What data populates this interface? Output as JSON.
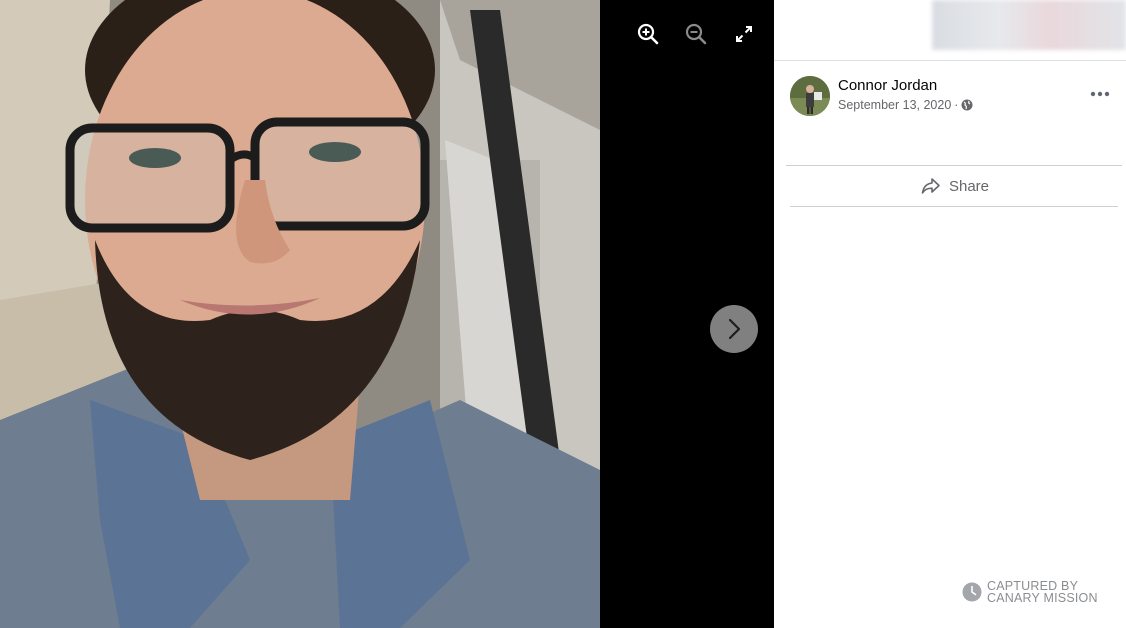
{
  "viewer": {
    "zoom_in": "zoom-in-icon",
    "zoom_out": "zoom-out-icon",
    "fullscreen": "expand-icon",
    "next": "chevron-right-icon"
  },
  "post": {
    "author": "Connor Jordan",
    "date": "September 13, 2020",
    "separator": "·",
    "privacy_icon": "globe-icon",
    "more_icon": "more-horizontal-icon",
    "share_label": "Share"
  },
  "watermark": {
    "line1": "CAPTURED BY",
    "line2": "CANARY MISSION"
  },
  "colors": {
    "viewer_bg": "#000000",
    "panel_bg": "#ffffff",
    "secondary_text": "#65676b",
    "primary_text": "#050505"
  }
}
